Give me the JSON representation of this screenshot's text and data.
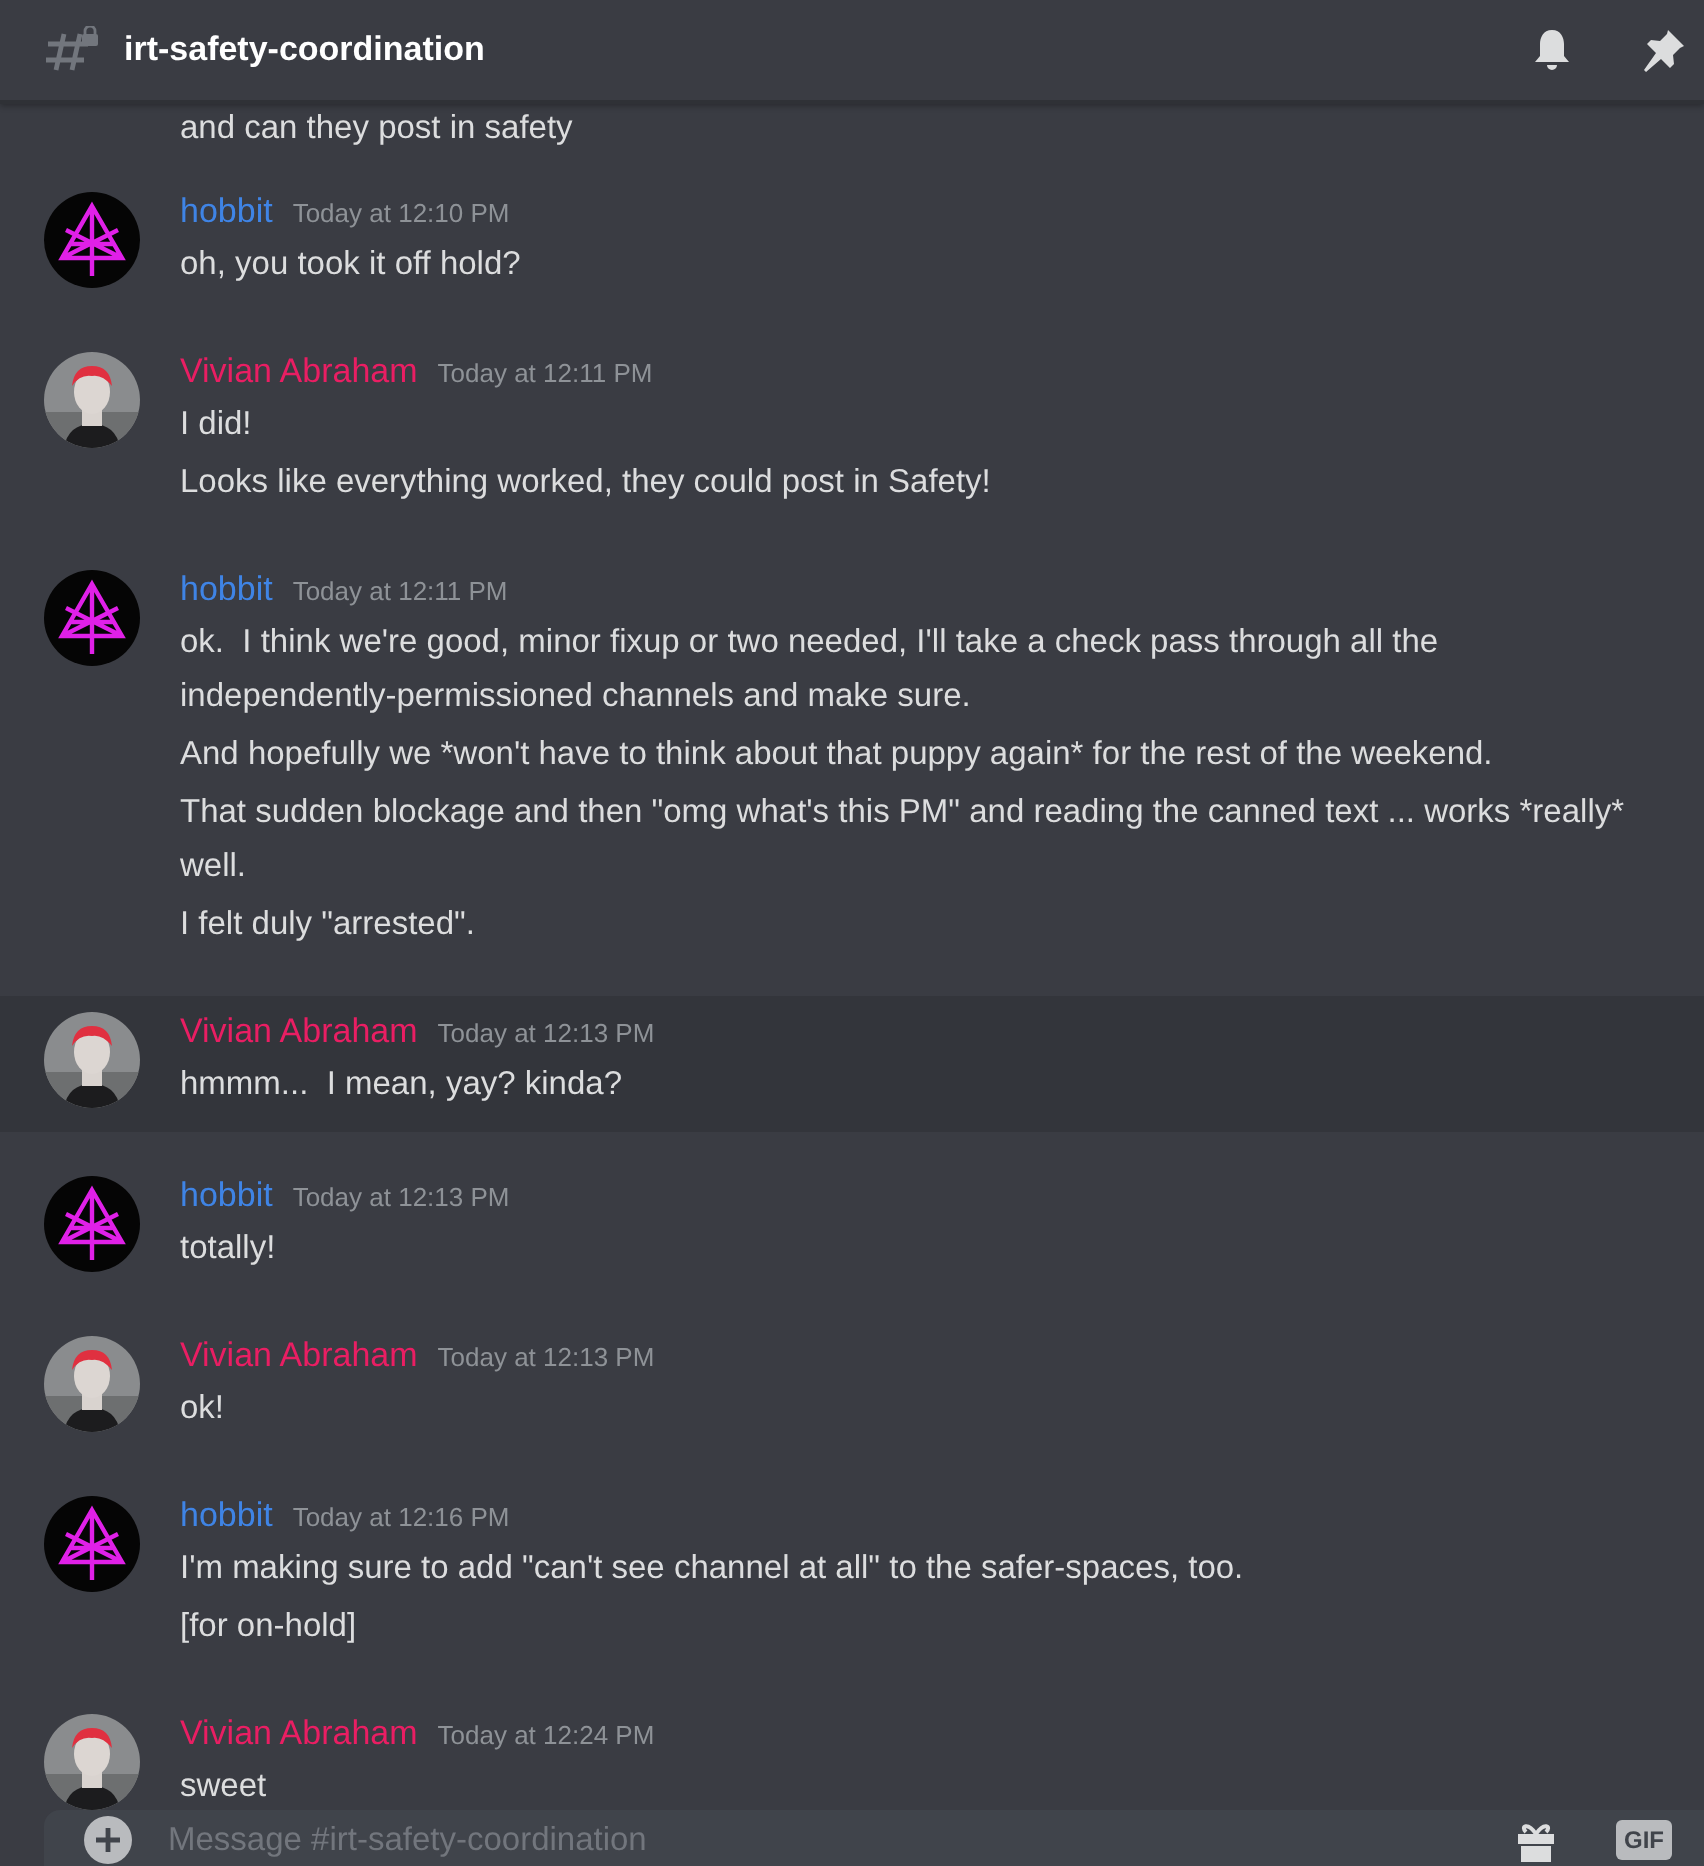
{
  "channel": {
    "name": "irt-safety-coordination"
  },
  "cut_off_line": "and can they post in safety",
  "groups": [
    {
      "author": "hobbit",
      "kind": "sigil",
      "color": "#3f84e5",
      "time": "Today at 12:10 PM",
      "highlighted": false,
      "lines": [
        "oh, you took it off hold?"
      ]
    },
    {
      "author": "Vivian Abraham",
      "color": "#e91e63",
      "time": "Today at 12:11 PM",
      "highlighted": false,
      "lines": [
        "I did!",
        "Looks like everything worked, they could post in Safety!"
      ]
    },
    {
      "author": "hobbit",
      "kind": "sigil",
      "color": "#3f84e5",
      "time": "Today at 12:11 PM",
      "highlighted": false,
      "lines": [
        "ok.  I think we're good, minor fixup or two needed, I'll take a check pass through all the independently-permissioned channels and make sure.",
        "And hopefully we *won't have to think about that puppy again* for the rest of the weekend.",
        "That sudden blockage and then \"omg what's this PM\" and reading the canned text ... works *really* well.",
        "I felt duly \"arrested\"."
      ]
    },
    {
      "author": "Vivian Abraham",
      "color": "#e91e63",
      "time": "Today at 12:13 PM",
      "highlighted": true,
      "lines": [
        "hmmm...  I mean, yay? kinda?"
      ]
    },
    {
      "author": "hobbit",
      "kind": "sigil",
      "color": "#3f84e5",
      "time": "Today at 12:13 PM",
      "highlighted": false,
      "lines": [
        "totally!"
      ]
    },
    {
      "author": "Vivian Abraham",
      "color": "#e91e63",
      "time": "Today at 12:13 PM",
      "highlighted": false,
      "lines": [
        "ok!"
      ]
    },
    {
      "author": "hobbit",
      "kind": "sigil",
      "color": "#3f84e5",
      "time": "Today at 12:16 PM",
      "highlighted": false,
      "lines": [
        "I'm making sure to add \"can't see channel at all\" to the safer-spaces, too.",
        "[for on-hold]"
      ]
    },
    {
      "author": "Vivian Abraham",
      "color": "#e91e63",
      "time": "Today at 12:24 PM",
      "highlighted": false,
      "lines": [
        "sweet"
      ]
    }
  ],
  "composer": {
    "placeholder": "Message #irt-safety-coordination",
    "gif_label": "GIF"
  }
}
